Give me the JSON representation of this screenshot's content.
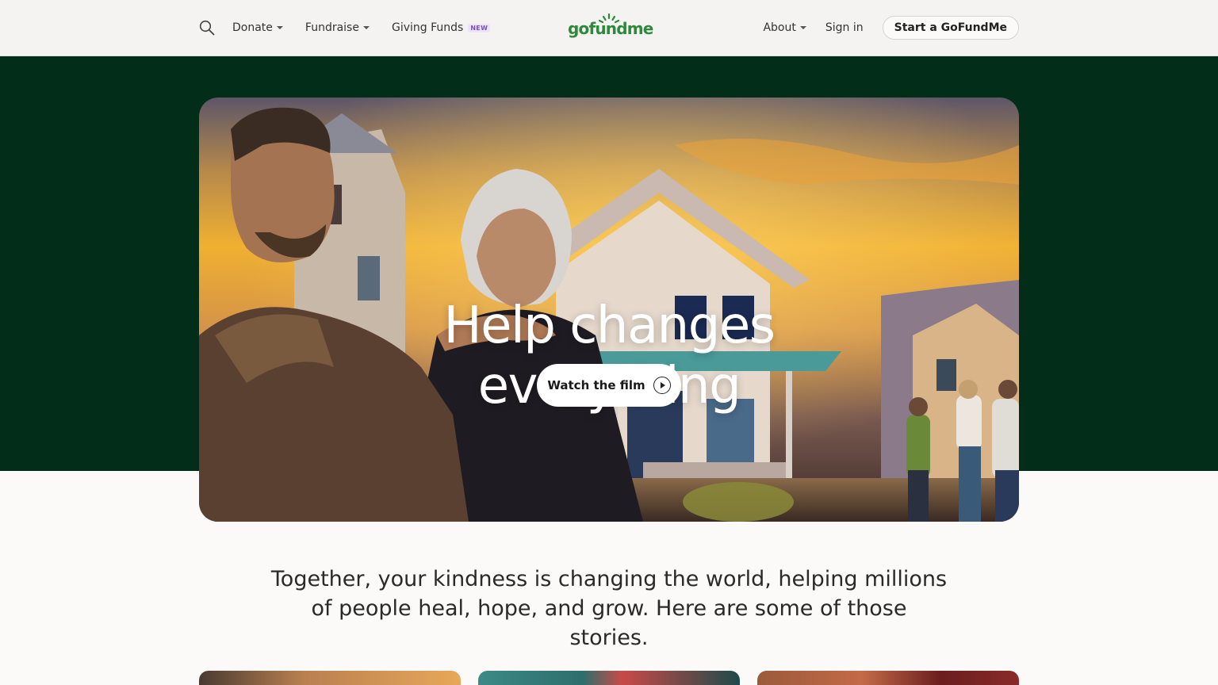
{
  "header": {
    "search_icon": "search-icon",
    "nav_left": [
      {
        "label": "Donate",
        "has_caret": true
      },
      {
        "label": "Fundraise",
        "has_caret": true
      },
      {
        "label": "Giving Funds",
        "badge": "NEW"
      }
    ],
    "logo": "gofundme",
    "nav_right": [
      {
        "label": "About",
        "has_caret": true
      },
      {
        "label": "Sign in"
      }
    ],
    "start_button": "Start a GoFundMe"
  },
  "hero": {
    "title_line1": "Help changes",
    "title_line2": "everything",
    "watch_button": "Watch the film",
    "play_icon": "play-circle-icon"
  },
  "intro": {
    "text": "Together, your kindness is changing the world, helping millions of people heal, hope, and grow. Here are some of those stories."
  },
  "colors": {
    "brand_green": "#2d8a3a",
    "dark_band": "#012d19",
    "header_bg": "#f4f3f1",
    "page_bg": "#fbfaf8"
  }
}
